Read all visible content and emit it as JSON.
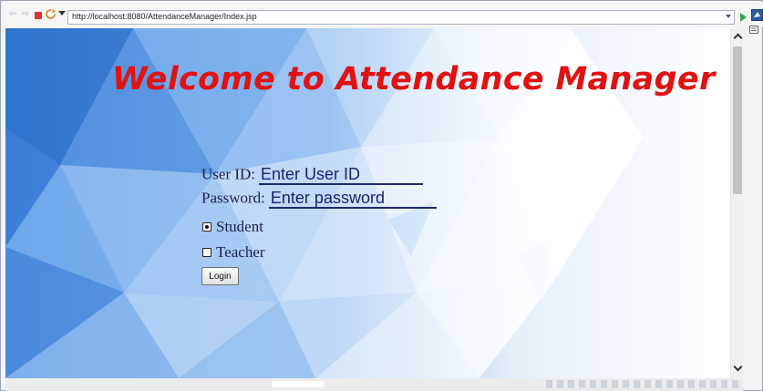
{
  "toolbar": {
    "url": "http://localhost:8080/AttendanceManager/Index.jsp",
    "icons": [
      "back-arrow-icon",
      "forward-arrow-icon",
      "stop-icon",
      "refresh-icon",
      "menu-caret-icon",
      "dropdown-icon",
      "go-icon",
      "webview-icon"
    ]
  },
  "page": {
    "heading": "Welcome to Attendance Manager",
    "heading_color": "#e01212",
    "form": {
      "userid_label": "User ID:",
      "userid_placeholder": "Enter User ID",
      "password_label": "Password:",
      "password_placeholder": "Enter password",
      "roles": [
        {
          "label": "Student",
          "checked": true
        },
        {
          "label": "Teacher",
          "checked": false
        }
      ],
      "login_label": "Login"
    }
  }
}
